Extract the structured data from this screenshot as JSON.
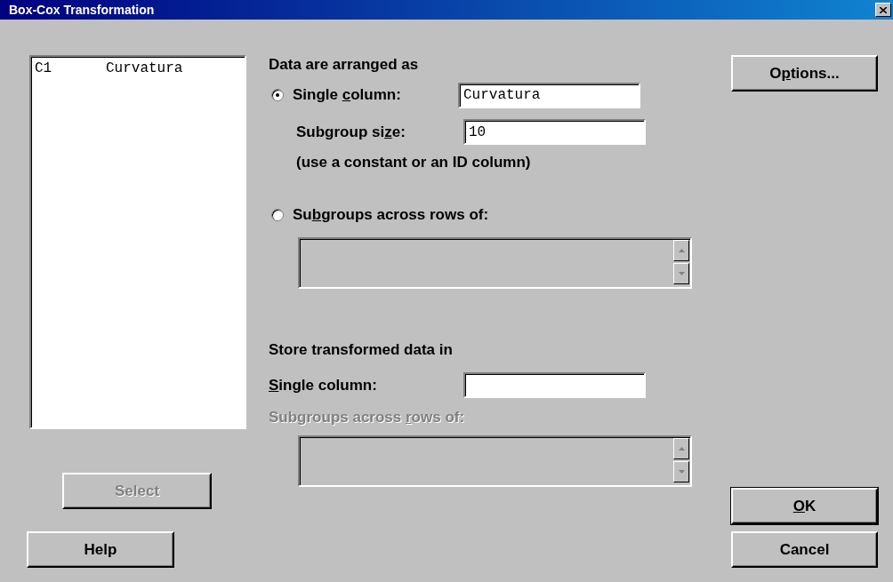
{
  "window": {
    "title": "Box-Cox Transformation"
  },
  "variables_list": {
    "items": [
      {
        "column": "C1",
        "name": "Curvatura"
      }
    ]
  },
  "select_button": {
    "label": [
      {
        "text": "Select",
        "underline": false
      }
    ],
    "disabled": true
  },
  "help_button": {
    "label": [
      {
        "text": "Help",
        "underline": false
      }
    ],
    "disabled": false
  },
  "arrangement": {
    "heading": "Data are arranged as",
    "options": [
      {
        "kind": "single",
        "selected": true,
        "label": [
          {
            "text": "Single ",
            "underline": false
          },
          {
            "text": "c",
            "underline": true
          },
          {
            "text": "olumn:",
            "underline": false
          }
        ],
        "value": "Curvatura",
        "subgroup_label": [
          {
            "text": "Subgroup si",
            "underline": false
          },
          {
            "text": "z",
            "underline": true
          },
          {
            "text": "e:",
            "underline": false
          }
        ],
        "subgroup_value": "10",
        "note": "(use a constant or an ID column)"
      },
      {
        "kind": "across",
        "selected": false,
        "label": [
          {
            "text": "Su",
            "underline": false
          },
          {
            "text": "b",
            "underline": true
          },
          {
            "text": "groups across rows of:",
            "underline": false
          }
        ]
      }
    ]
  },
  "store": {
    "heading": "Store transformed data in",
    "single_label": [
      {
        "text": "S",
        "underline": true
      },
      {
        "text": "ingle column:",
        "underline": false
      }
    ],
    "across_label": [
      {
        "text": "Subgroups across ",
        "underline": false
      },
      {
        "text": "r",
        "underline": true
      },
      {
        "text": "ows of:",
        "underline": false
      }
    ],
    "across_disabled": true
  },
  "side_buttons": [
    {
      "kind": "options",
      "label": [
        {
          "text": "O",
          "underline": false
        },
        {
          "text": "p",
          "underline": true
        },
        {
          "text": "tions...",
          "underline": false
        }
      ],
      "default": false
    },
    {
      "kind": "ok",
      "label": [
        {
          "text": "O",
          "underline": true
        },
        {
          "text": "K",
          "underline": false
        }
      ],
      "default": true
    },
    {
      "kind": "cancel",
      "label": [
        {
          "text": "Cancel",
          "underline": false
        }
      ],
      "default": false
    }
  ]
}
